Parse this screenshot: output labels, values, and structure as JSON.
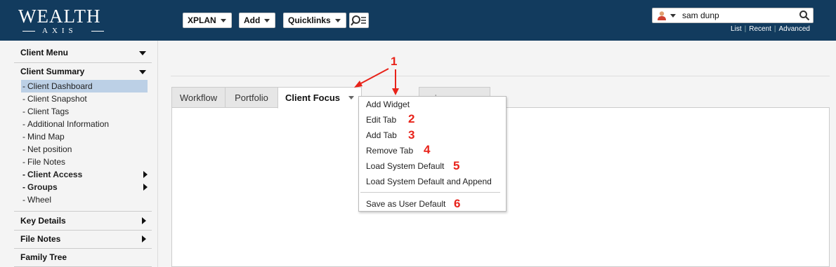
{
  "header": {
    "logo_main": "WEALTH",
    "logo_sub": "AXIS",
    "buttons": [
      {
        "label": "XPLAN"
      },
      {
        "label": "Add"
      },
      {
        "label": "Quicklinks"
      }
    ],
    "search": {
      "value": "sam dunp",
      "links": [
        "List",
        "Recent",
        "Advanced"
      ]
    }
  },
  "sidebar": {
    "client_menu": "Client Menu",
    "client_summary": "Client Summary",
    "items": [
      {
        "label": "Client Dashboard"
      },
      {
        "label": "Client Snapshot"
      },
      {
        "label": "Client Tags"
      },
      {
        "label": "Additional Information"
      },
      {
        "label": "Mind Map"
      },
      {
        "label": "Net position"
      },
      {
        "label": "File Notes"
      },
      {
        "label": "Client Access"
      },
      {
        "label": "Groups"
      },
      {
        "label": "Wheel"
      }
    ],
    "key_details": "Key Details",
    "file_notes": "File Notes",
    "family_tree": "Family Tree"
  },
  "tabs": [
    {
      "label": "Workflow"
    },
    {
      "label": "Portfolio"
    },
    {
      "label": "Client Focus"
    },
    {
      "label": "Insurance"
    }
  ],
  "menu": {
    "items": [
      {
        "label": "Add Widget"
      },
      {
        "label": "Edit Tab"
      },
      {
        "label": "Add Tab"
      },
      {
        "label": "Remove Tab"
      },
      {
        "label": "Load System Default"
      },
      {
        "label": "Load System Default and Append"
      },
      {
        "label": "Save as User Default"
      }
    ]
  },
  "annotations": [
    "1",
    "2",
    "3",
    "4",
    "5",
    "6"
  ],
  "colors": {
    "header_bg": "#123b5e",
    "active_item_bg": "#bcd0e6",
    "annotation_red": "#e8231a"
  }
}
